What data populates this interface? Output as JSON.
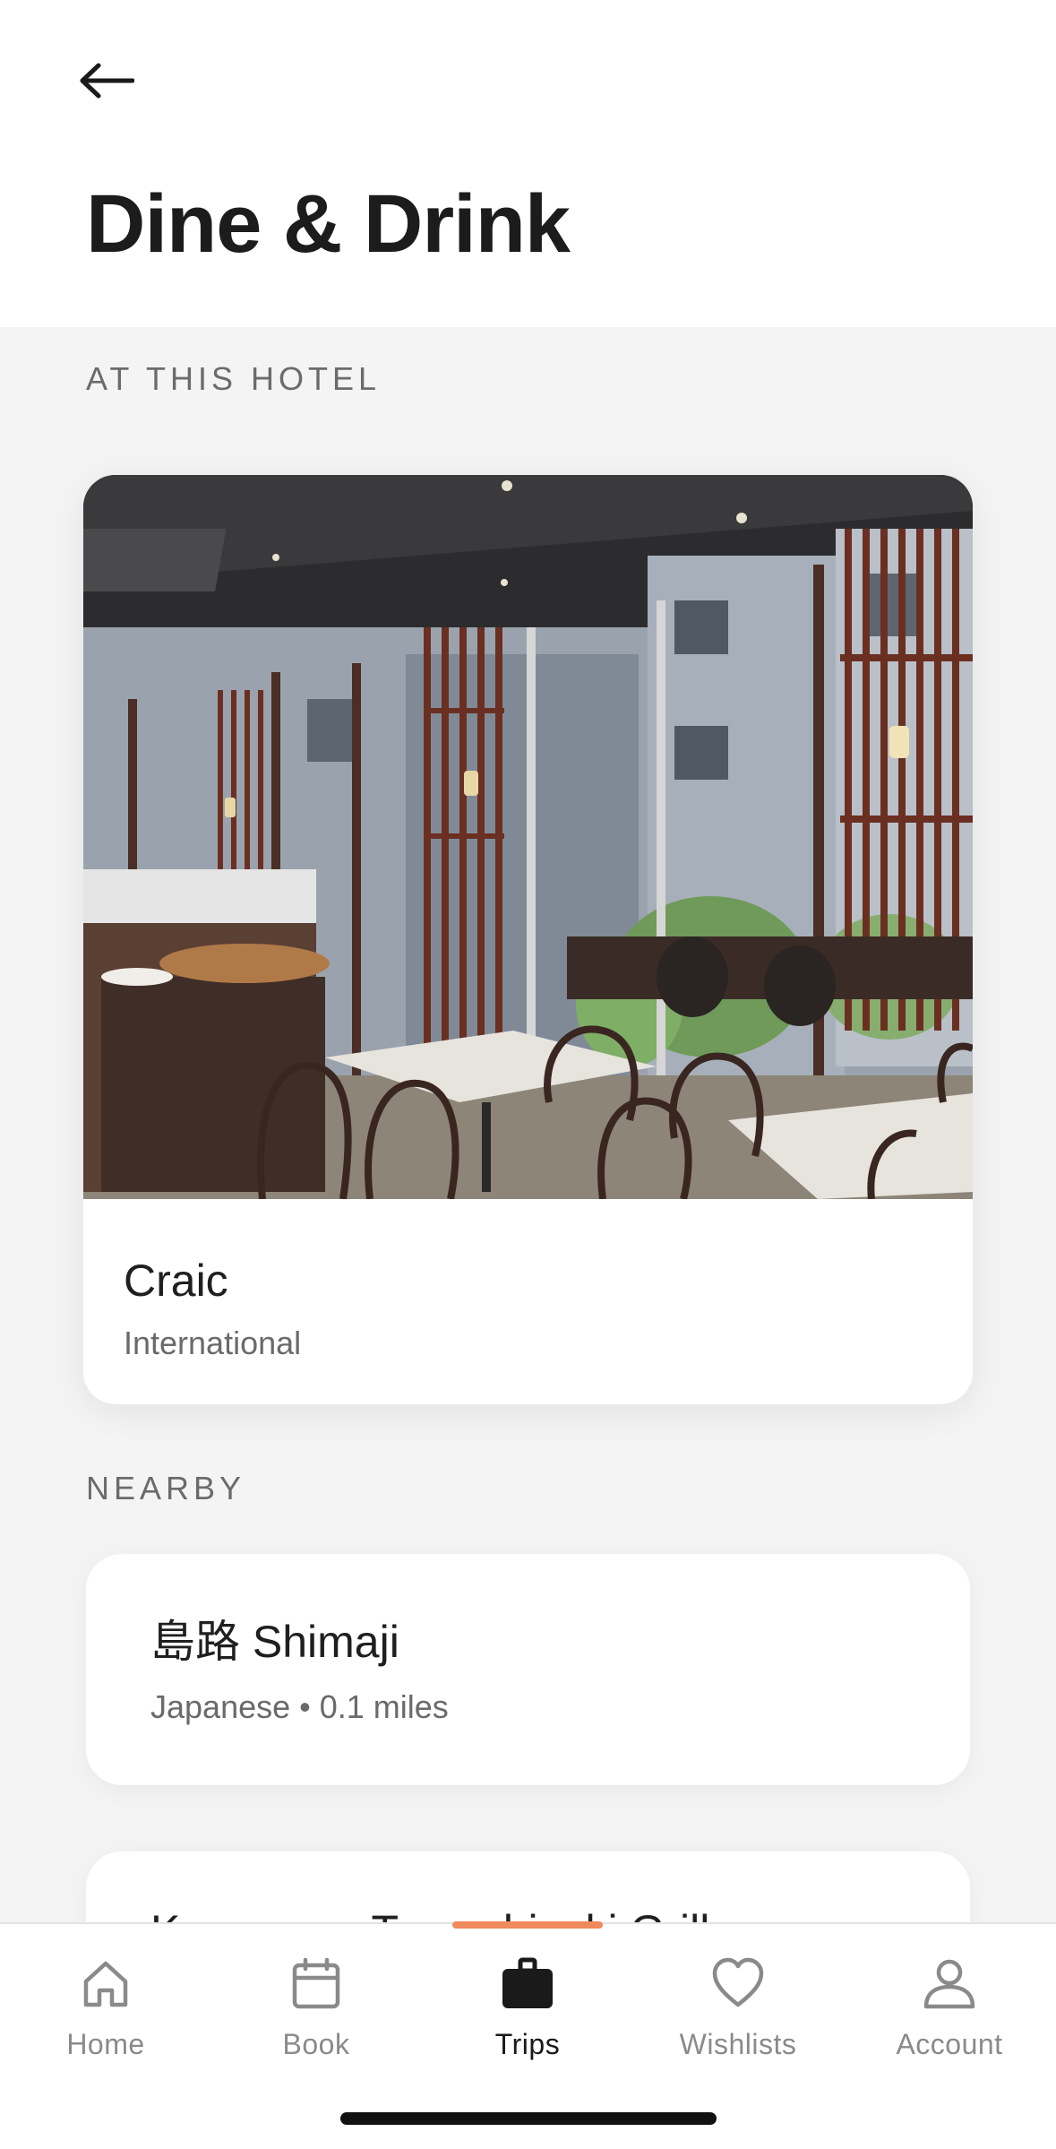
{
  "header": {
    "back_icon": "arrow-left-icon",
    "title": "Dine & Drink"
  },
  "at_this_hotel": {
    "label": "AT THIS HOTEL",
    "restaurant": {
      "name": "Craic",
      "cuisine": "International"
    }
  },
  "nearby": {
    "label": "NEARBY",
    "items": [
      {
        "name": "島路 Shimaji",
        "meta": "Japanese • 0.1 miles"
      },
      {
        "name": "Kanazawa Tomoshizuki Grill",
        "meta": ""
      }
    ]
  },
  "tabbar": {
    "tabs": [
      {
        "label": "Home",
        "icon": "home-icon"
      },
      {
        "label": "Book",
        "icon": "calendar-icon"
      },
      {
        "label": "Trips",
        "icon": "briefcase-icon"
      },
      {
        "label": "Wishlists",
        "icon": "heart-icon"
      },
      {
        "label": "Account",
        "icon": "person-icon"
      }
    ],
    "active": "Trips",
    "accent_color": "#f08a5d"
  }
}
